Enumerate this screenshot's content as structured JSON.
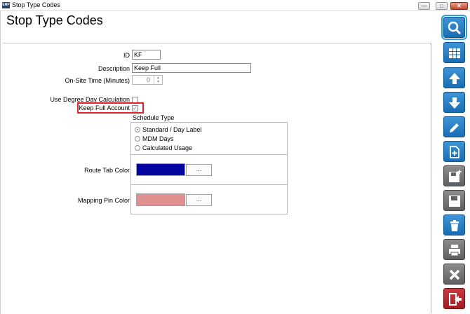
{
  "window": {
    "title": "Stop Type Codes",
    "app_icon_text": "ERP",
    "minimize_label": "—",
    "maximize_label": "□",
    "close_label": "✕"
  },
  "page": {
    "title": "Stop Type Codes"
  },
  "form": {
    "id_label": "ID",
    "id_value": "KF",
    "description_label": "Description",
    "description_value": "Keep Full",
    "onsite_label": "On-Site Time (Minutes)",
    "onsite_value": "0",
    "degree_day_label": "Use Degree Day Calculation",
    "degree_day_checked": false,
    "keep_full_label": "Keep Full Account",
    "keep_full_checked": true,
    "schedule_type_label": "Schedule Type",
    "schedule_options": [
      {
        "label": "Standard / Day Label",
        "selected": true
      },
      {
        "label": "MDM Days",
        "selected": false
      },
      {
        "label": "Calculated Usage",
        "selected": false
      }
    ],
    "route_tab_color_label": "Route Tab Color",
    "route_tab_color": "#0404a0",
    "mapping_pin_color_label": "Mapping Pin Color",
    "mapping_pin_color": "#e09090",
    "browse_button_label": "..."
  },
  "toolbar": [
    {
      "name": "search-icon",
      "color": "blue",
      "active": true
    },
    {
      "name": "grid-icon",
      "color": "blue"
    },
    {
      "name": "arrow-up-icon",
      "color": "blue"
    },
    {
      "name": "arrow-down-icon",
      "color": "blue"
    },
    {
      "name": "pencil-icon",
      "color": "blue"
    },
    {
      "name": "new-document-icon",
      "color": "blue"
    },
    {
      "name": "save-new-icon",
      "color": "gray"
    },
    {
      "name": "save-icon",
      "color": "gray"
    },
    {
      "name": "trash-icon",
      "color": "blue"
    },
    {
      "name": "print-icon",
      "color": "gray"
    },
    {
      "name": "cancel-icon",
      "color": "gray"
    },
    {
      "name": "exit-icon",
      "color": "red"
    }
  ]
}
